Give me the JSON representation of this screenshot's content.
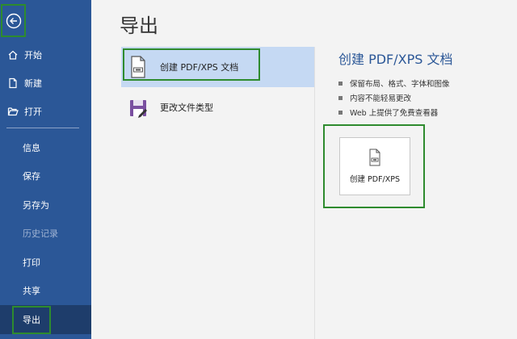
{
  "sidebar": {
    "top_items": [
      {
        "label": "开始",
        "icon": "home-icon"
      },
      {
        "label": "新建",
        "icon": "new-document-icon"
      },
      {
        "label": "打开",
        "icon": "folder-open-icon"
      }
    ],
    "sub_items": [
      {
        "label": "信息"
      },
      {
        "label": "保存"
      },
      {
        "label": "另存为"
      },
      {
        "label": "历史记录",
        "disabled": true
      },
      {
        "label": "打印"
      },
      {
        "label": "共享"
      },
      {
        "label": "导出",
        "active": true
      }
    ]
  },
  "main": {
    "title": "导出",
    "options": [
      {
        "label": "创建 PDF/XPS 文档",
        "icon": "pdf-document-icon",
        "selected": true
      },
      {
        "label": "更改文件类型",
        "icon": "change-file-type-icon"
      }
    ],
    "detail": {
      "title": "创建 PDF/XPS 文档",
      "bullets": [
        "保留布局、格式、字体和图像",
        "内容不能轻易更改",
        "Web 上提供了免费查看器"
      ],
      "button_label": "创建 PDF/XPS"
    }
  },
  "colors": {
    "sidebar_bg": "#2b5797",
    "active_bg": "#1e3d6b",
    "selected_bg": "#c5d9f3",
    "highlight_border": "#2e8b2e",
    "accent_text": "#2b5797"
  }
}
